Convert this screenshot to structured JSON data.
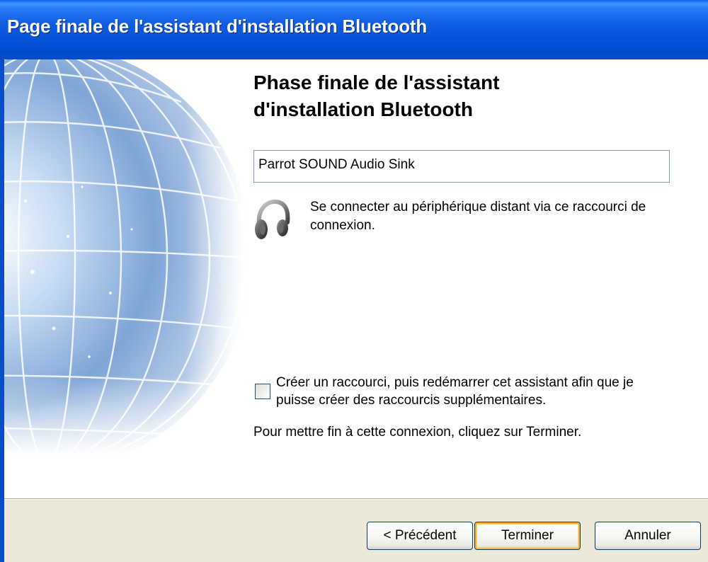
{
  "window": {
    "title": "Page finale de l'assistant d'installation Bluetooth"
  },
  "heading": {
    "line1": "Phase finale de l'assistant",
    "line2": "d'installation Bluetooth"
  },
  "device": {
    "name": "Parrot SOUND Audio Sink",
    "icon": "headphones-icon",
    "description": "Se connecter au périphérique distant via ce raccourci de connexion."
  },
  "shortcut_option": {
    "checked": false,
    "label": "Créer un raccourci, puis redémarrer cet assistant afin que je puisse créer des raccourcis supplémentaires."
  },
  "finish_instruction": "Pour mettre fin à cette connexion, cliquez sur Terminer.",
  "buttons": {
    "previous": "< Précédent",
    "finish": "Terminer",
    "cancel": "Annuler"
  },
  "colors": {
    "titlebar": "#0552D8",
    "dialog_face": "#ECE9D8",
    "default_button_focus": "#F8B330"
  }
}
